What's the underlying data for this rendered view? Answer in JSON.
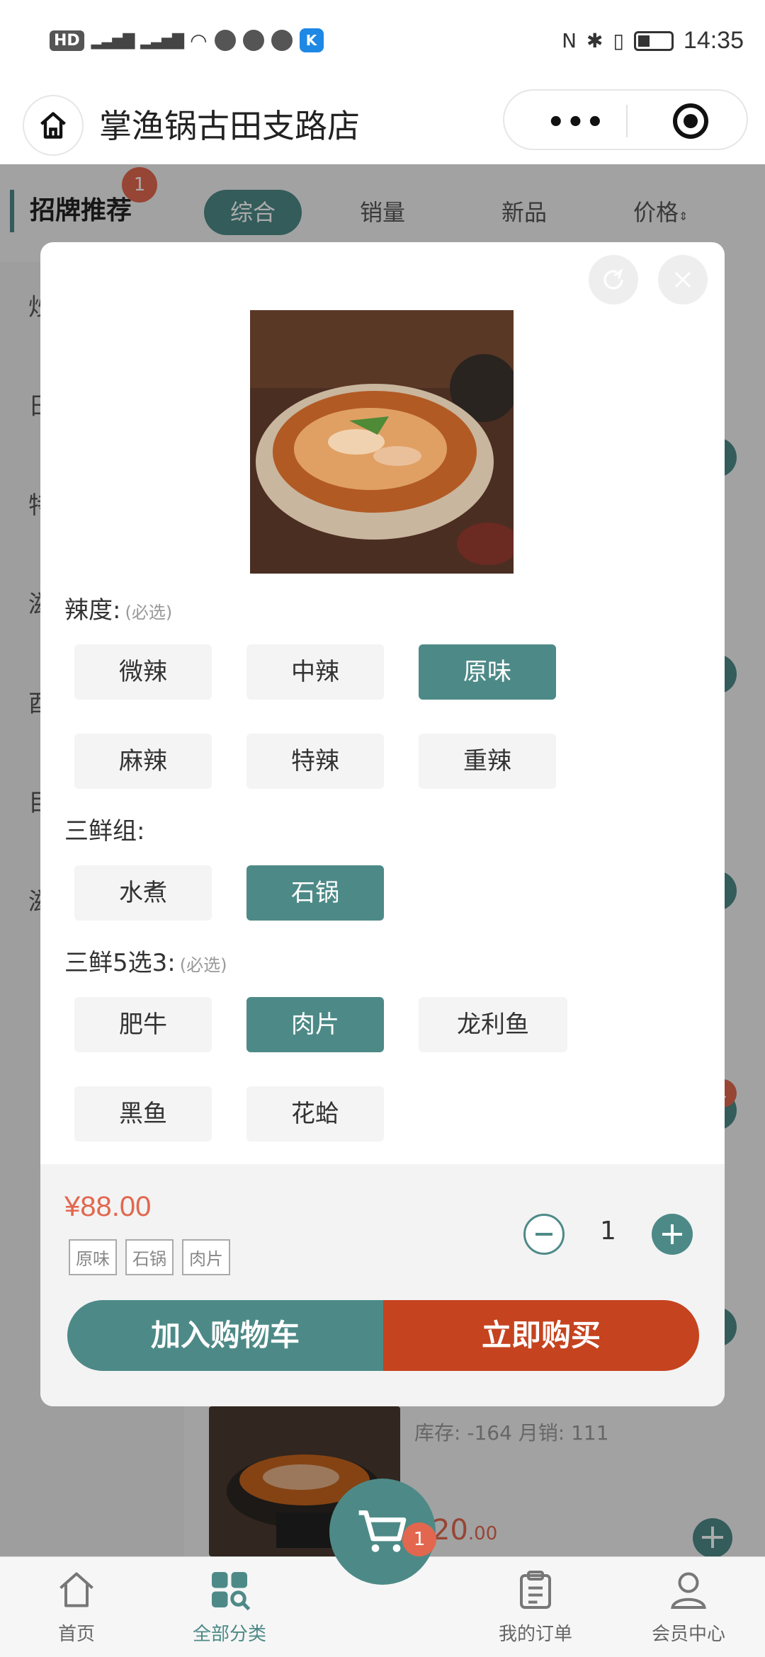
{
  "status_bar": {
    "left_tags": [
      "HD",
      "4G",
      "4G"
    ],
    "time": "14:35"
  },
  "nav": {
    "title": "掌渔锅古田支路店",
    "more_label": "•••"
  },
  "page": {
    "active_category": "招牌推荐",
    "category_badge": "1",
    "sort_tabs": [
      "综合",
      "销量",
      "新品",
      "价格"
    ],
    "side_items": [
      "炒",
      "日",
      "特",
      "滋",
      "酉",
      "目",
      "滋"
    ],
    "edge_badge": "1",
    "product_info": "库存: -164  月销: 111",
    "product_price_main": "20",
    "product_price_cents": ".00",
    "product_add": "+"
  },
  "modal": {
    "groups": [
      {
        "label": "辣度:",
        "required": "(必选)",
        "options": [
          "微辣",
          "中辣",
          "原味",
          "麻辣",
          "特辣",
          "重辣"
        ],
        "selected": "原味"
      },
      {
        "label": "三鲜组:",
        "required": "",
        "options": [
          "水煮",
          "石锅"
        ],
        "selected": "石锅"
      },
      {
        "label": "三鲜5选3:",
        "required": "(必选)",
        "options": [
          "肥牛",
          "肉片",
          "龙利鱼",
          "黑鱼",
          "花蛤"
        ],
        "selected": "肉片"
      }
    ],
    "price": "¥88.00",
    "tags": [
      "原味",
      "石锅",
      "肉片"
    ],
    "quantity": "1",
    "add_to_cart": "加入购物车",
    "buy_now": "立即购买"
  },
  "tabbar": {
    "items": [
      "首页",
      "全部分类",
      "我的订单",
      "会员中心"
    ],
    "active": "全部分类",
    "cart_badge": "1"
  },
  "colors": {
    "accent": "#4d8a87",
    "buy": "#c5431f",
    "price": "#e2674e"
  }
}
